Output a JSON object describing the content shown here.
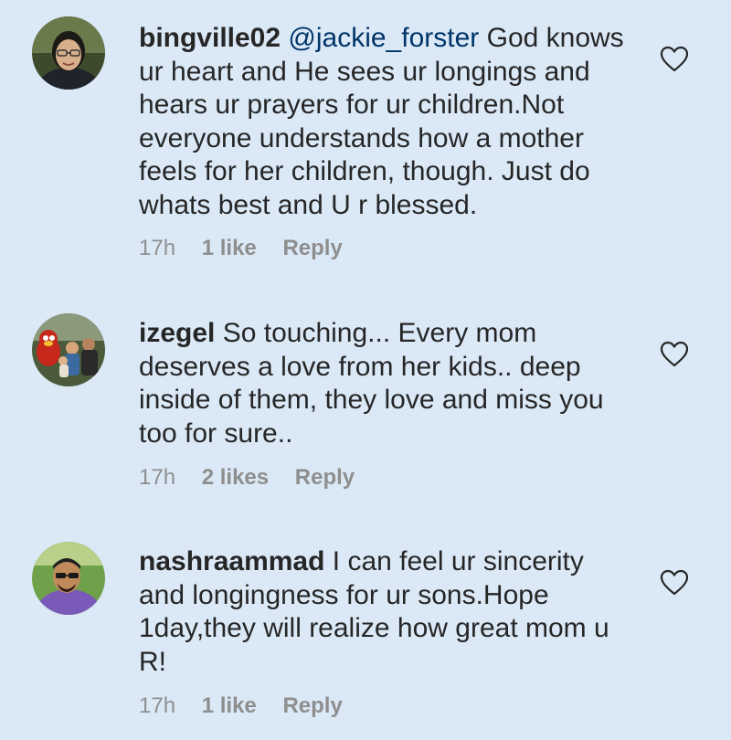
{
  "comments": [
    {
      "username": "bingville02",
      "mention": "@jackie_forster",
      "text": "God knows ur heart and He sees ur longings and hears ur prayers for ur children.Not everyone understands how a mother feels for her children, though. Just do whats best and U r blessed.",
      "time": "17h",
      "likes": "1 like",
      "reply": "Reply",
      "avatar_icon": "woman-with-glasses-avatar"
    },
    {
      "username": "izegel",
      "mention": "",
      "text": "So touching... Every mom deserves a love from her kids.. deep inside of them, they love and miss you too for sure..",
      "time": "17h",
      "likes": "2 likes",
      "reply": "Reply",
      "avatar_icon": "family-group-photo-avatar"
    },
    {
      "username": "nashraammad",
      "mention": "",
      "text": "I can feel ur sincerity and longingness for ur sons.Hope 1day,they will realize how great mom u R!",
      "time": "17h",
      "likes": "1 like",
      "reply": "Reply",
      "avatar_icon": "man-with-sunglasses-avatar"
    }
  ],
  "colors": {
    "background": "#dbe9f7",
    "text": "#262626",
    "mention": "#003569",
    "meta": "#8e8e8e"
  }
}
